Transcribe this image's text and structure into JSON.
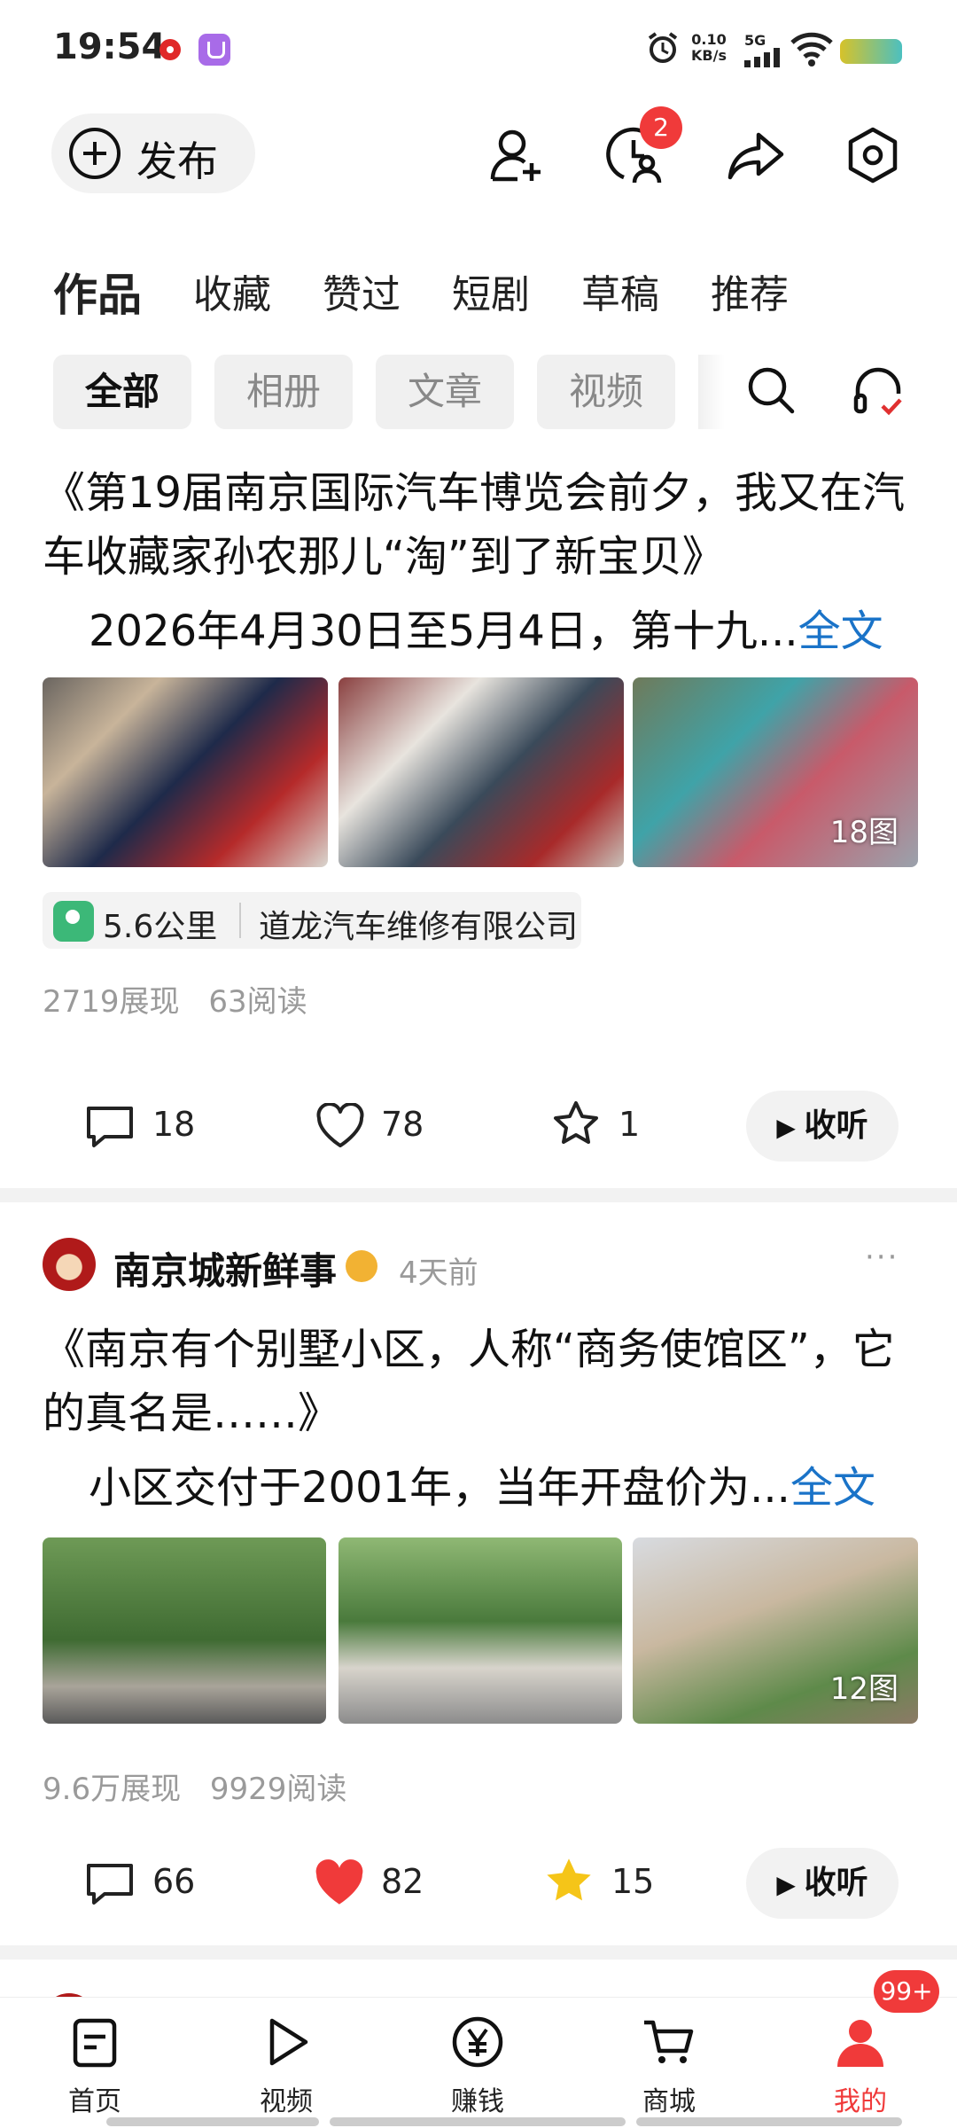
{
  "status_bar": {
    "time": "19:54",
    "net_speed": "0.10",
    "net_unit": "KB/s",
    "signal": "5G"
  },
  "header": {
    "publish_label": "发布",
    "messages_badge": "2"
  },
  "tabs": [
    "作品",
    "收藏",
    "赞过",
    "短剧",
    "草稿",
    "推荐"
  ],
  "filter_chips": [
    "全部",
    "相册",
    "文章",
    "视频"
  ],
  "posts": [
    {
      "title": "《第19届南京国际汽车博览会前夕，我又在汽车收藏家孙农那儿“淘”到了新宝贝》",
      "excerpt": "2026年4月30日至5月4日，第十九...",
      "more_label": "全文",
      "image_count": "18图",
      "location_distance": "5.6公里",
      "location_name": "道龙汽车维修有限公司",
      "views": "2719展现",
      "reads": "63阅读",
      "comments": "18",
      "likes": "78",
      "favorites": "1",
      "listen_label": "收听"
    },
    {
      "author": "南京城新鲜事",
      "time_ago": "4天前",
      "title": "《南京有个别墅小区，人称“商务使馆区”，它的真名是……》",
      "excerpt": "小区交付于2001年，当年开盘价为...",
      "more_label": "全文",
      "image_count": "12图",
      "views": "9.6万展现",
      "reads": "9929阅读",
      "comments": "66",
      "likes": "82",
      "favorites": "15",
      "listen_label": "收听"
    }
  ],
  "bottom_nav": {
    "items": [
      "首页",
      "视频",
      "赚钱",
      "商城",
      "我的"
    ],
    "profile_badge": "99+",
    "active_color": "#f03a3a"
  }
}
